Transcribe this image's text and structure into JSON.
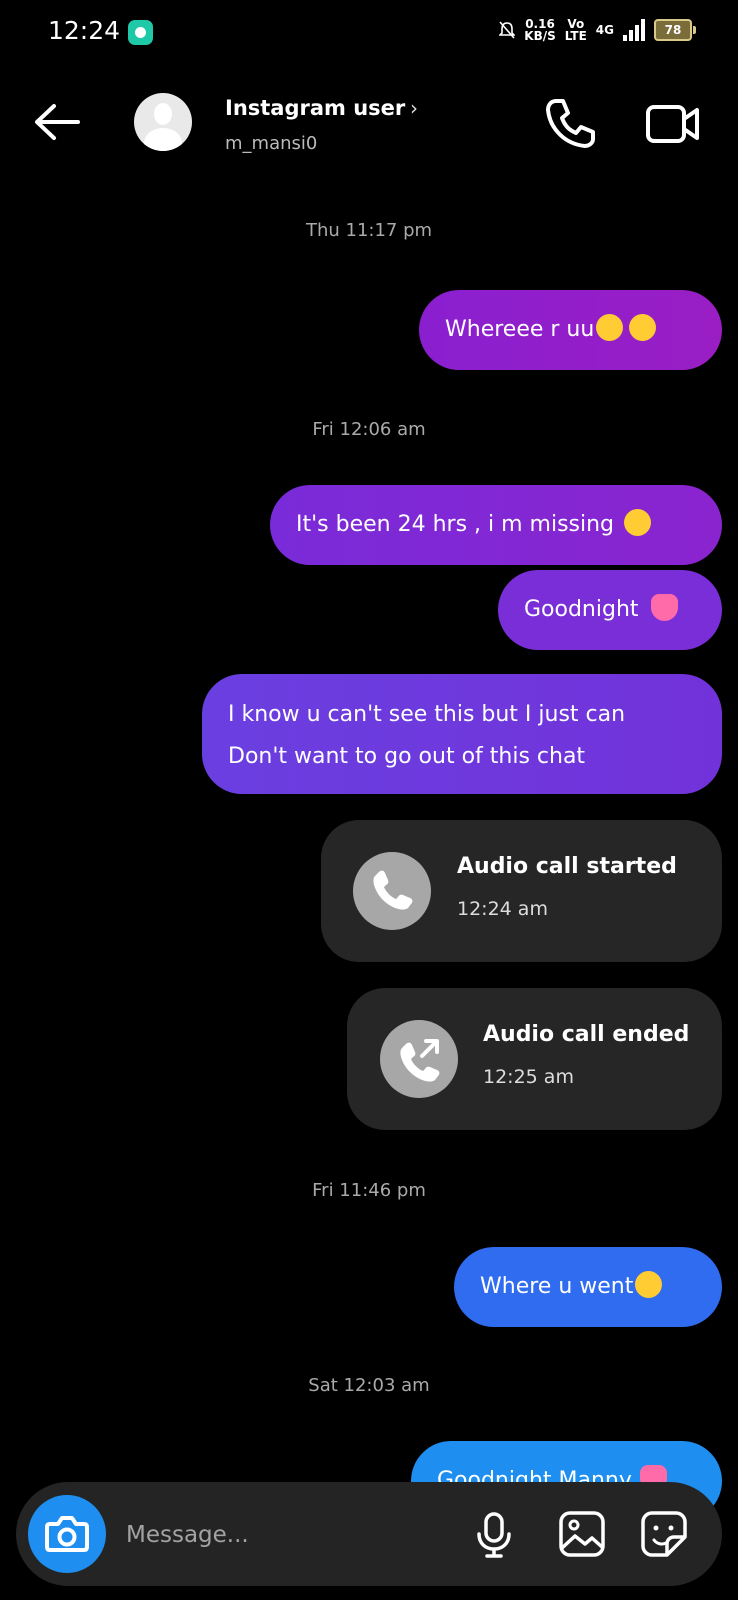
{
  "status_bar": {
    "time": "12:24",
    "net_speed": "0.16",
    "net_unit": "KB/S",
    "volte_top": "Vo",
    "volte_bottom": "LTE",
    "network": "4G",
    "battery": "78"
  },
  "header": {
    "title": "Instagram user",
    "username": "m_mansi0",
    "chevron": "›",
    "icons": [
      "back-arrow-icon",
      "profile-icon",
      "phone-icon",
      "video-icon"
    ]
  },
  "messages": [
    {
      "type": "timestamp",
      "text": "Thu 11:17 pm"
    },
    {
      "type": "sent",
      "text": "Whereee r uu",
      "emoji": [
        "loudly-crying-face",
        "loudly-crying-face"
      ]
    },
    {
      "type": "timestamp",
      "text": "Fri 12:06 am"
    },
    {
      "type": "sent",
      "text": "It's been 24 hrs , i m missing",
      "emoji": [
        "pleading-face"
      ]
    },
    {
      "type": "sent",
      "text": "Goodnight",
      "emoji": [
        "two-hearts"
      ]
    },
    {
      "type": "sent",
      "lines": [
        "I know u can't see this but I just can",
        "Don't want to go out of this chat"
      ]
    },
    {
      "type": "call",
      "title": "Audio call started",
      "time": "12:24 am",
      "icon": "phone-icon"
    },
    {
      "type": "call",
      "title": "Audio call ended",
      "time": "12:25 am",
      "icon": "phone-outgoing-icon"
    },
    {
      "type": "timestamp",
      "text": "Fri 11:46 pm"
    },
    {
      "type": "sent",
      "text": "Where u went",
      "emoji": [
        "pensive-face"
      ]
    },
    {
      "type": "timestamp",
      "text": "Sat 12:03 am"
    },
    {
      "type": "sent",
      "text": "Goodnight Manny",
      "emoji": [
        "heart"
      ]
    }
  ],
  "composer": {
    "placeholder": "Message...",
    "icons": [
      "camera-icon",
      "microphone-icon",
      "gallery-icon",
      "sticker-icon"
    ]
  },
  "colors": {
    "bubble_purple": "#8f1ec9",
    "bubble_violet": "#7a2ed8",
    "bubble_indigo": "#6c3edd",
    "bubble_blue": "#2f6cf0",
    "bubble_lightblue": "#1e8ff0",
    "card_bg": "#262626"
  }
}
